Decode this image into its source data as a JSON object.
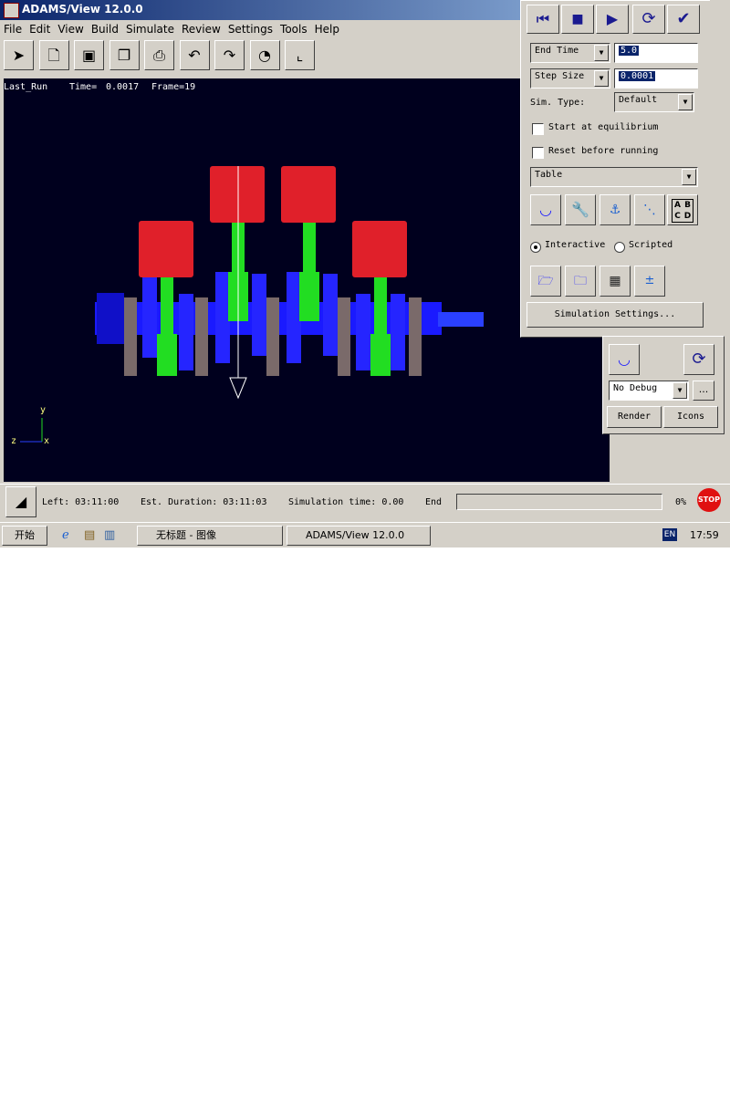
{
  "window": {
    "title": "ADAMS/View 12.0.0"
  },
  "menu": [
    "File",
    "Edit",
    "View",
    "Build",
    "Simulate",
    "Review",
    "Settings",
    "Tools",
    "Help"
  ],
  "viewport": {
    "run_name": "Last_Run",
    "time_label": "Time=",
    "time_value": "0.0017",
    "frame_label": "Frame=19",
    "axis_y": "y",
    "axis_z": "z",
    "axis_x": "x"
  },
  "status": {
    "left": "Left: 03:11:00",
    "est": "Est. Duration: 03:11:03",
    "sim": "Simulation time: 0.00",
    "end": "End ",
    "percent": "0%",
    "stop": "STOP"
  },
  "sim_panel": {
    "end_time_label": "End Time",
    "end_time_value": "5.0",
    "step_size_label": "Step Size",
    "step_size_value": "0.0001",
    "sim_type_label": "Sim. Type:",
    "sim_type_value": "Default",
    "start_eq_label": "Start at equilibrium",
    "reset_label": "Reset before running",
    "table_value": "Table",
    "abcd": [
      "A",
      "B",
      "C",
      "D"
    ],
    "interactive_label": "Interactive",
    "scripted_label": "Scripted",
    "settings_button": "Simulation Settings..."
  },
  "sub_panel": {
    "debug_value": "No Debug",
    "more": "...",
    "render_button": "Render",
    "icons_button": "Icons"
  },
  "taskbar": {
    "start": "开始",
    "task1": "无标题 - 图像",
    "task2": "ADAMS/View 12.0.0",
    "lang": "EN",
    "clock": "17:59"
  },
  "colors": {
    "viewport_bg": "#00001e",
    "piston": "#e0202a",
    "rod": "#22dd22",
    "crank": "#1a1aff",
    "counterweight": "#7a6a6a"
  }
}
